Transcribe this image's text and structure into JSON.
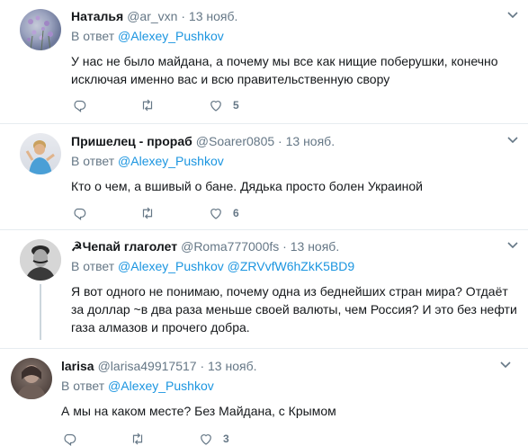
{
  "reply_prefix": "В ответ",
  "tweets": [
    {
      "name": "Наталья",
      "handle": "@ar_vxn",
      "separator": "·",
      "time": "13 нояб.",
      "mentions": [
        "@Alexey_Pushkov"
      ],
      "text": "У нас не было майдана, а почему мы все как нищие поберушки, конечно исключая именно вас и всю правительственную свору",
      "likes": "5"
    },
    {
      "name": "Пришелец - прораб",
      "handle": "@Soarer0805",
      "separator": "·",
      "time": "13 нояб.",
      "mentions": [
        "@Alexey_Pushkov"
      ],
      "text": "Кто о чем, а вшивый о бане. Дядька просто болен Украиной",
      "likes": "6"
    },
    {
      "name": "Чепай глаголет",
      "name_glyph": "☭",
      "handle": "@Roma777000fs",
      "separator": "·",
      "time": "13 нояб.",
      "mentions": [
        "@Alexey_Pushkov",
        "@ZRVvfW6hZkK5BD9"
      ],
      "text": "Я вот одного не понимаю, почему одна из беднейших стран мира? Отдаёт за доллар ~в два раза меньше  своей валюты, чем Россия? И это без нефти газа алмазов и прочего добра.",
      "likes": ""
    },
    {
      "name": "larisa",
      "handle": "@larisa49917517",
      "separator": "·",
      "time": "13 нояб.",
      "mentions": [
        "@Alexey_Pushkov"
      ],
      "text": "А мы на каком месте? Без Майдана, с Крымом",
      "likes": "3"
    }
  ],
  "icons": {
    "reply": "reply-icon",
    "retweet": "retweet-icon",
    "like": "heart-icon",
    "more": "chevron-down-icon"
  },
  "colors": {
    "link": "#1b95e0",
    "secondary": "#657786",
    "border": "#e6ecf0"
  }
}
